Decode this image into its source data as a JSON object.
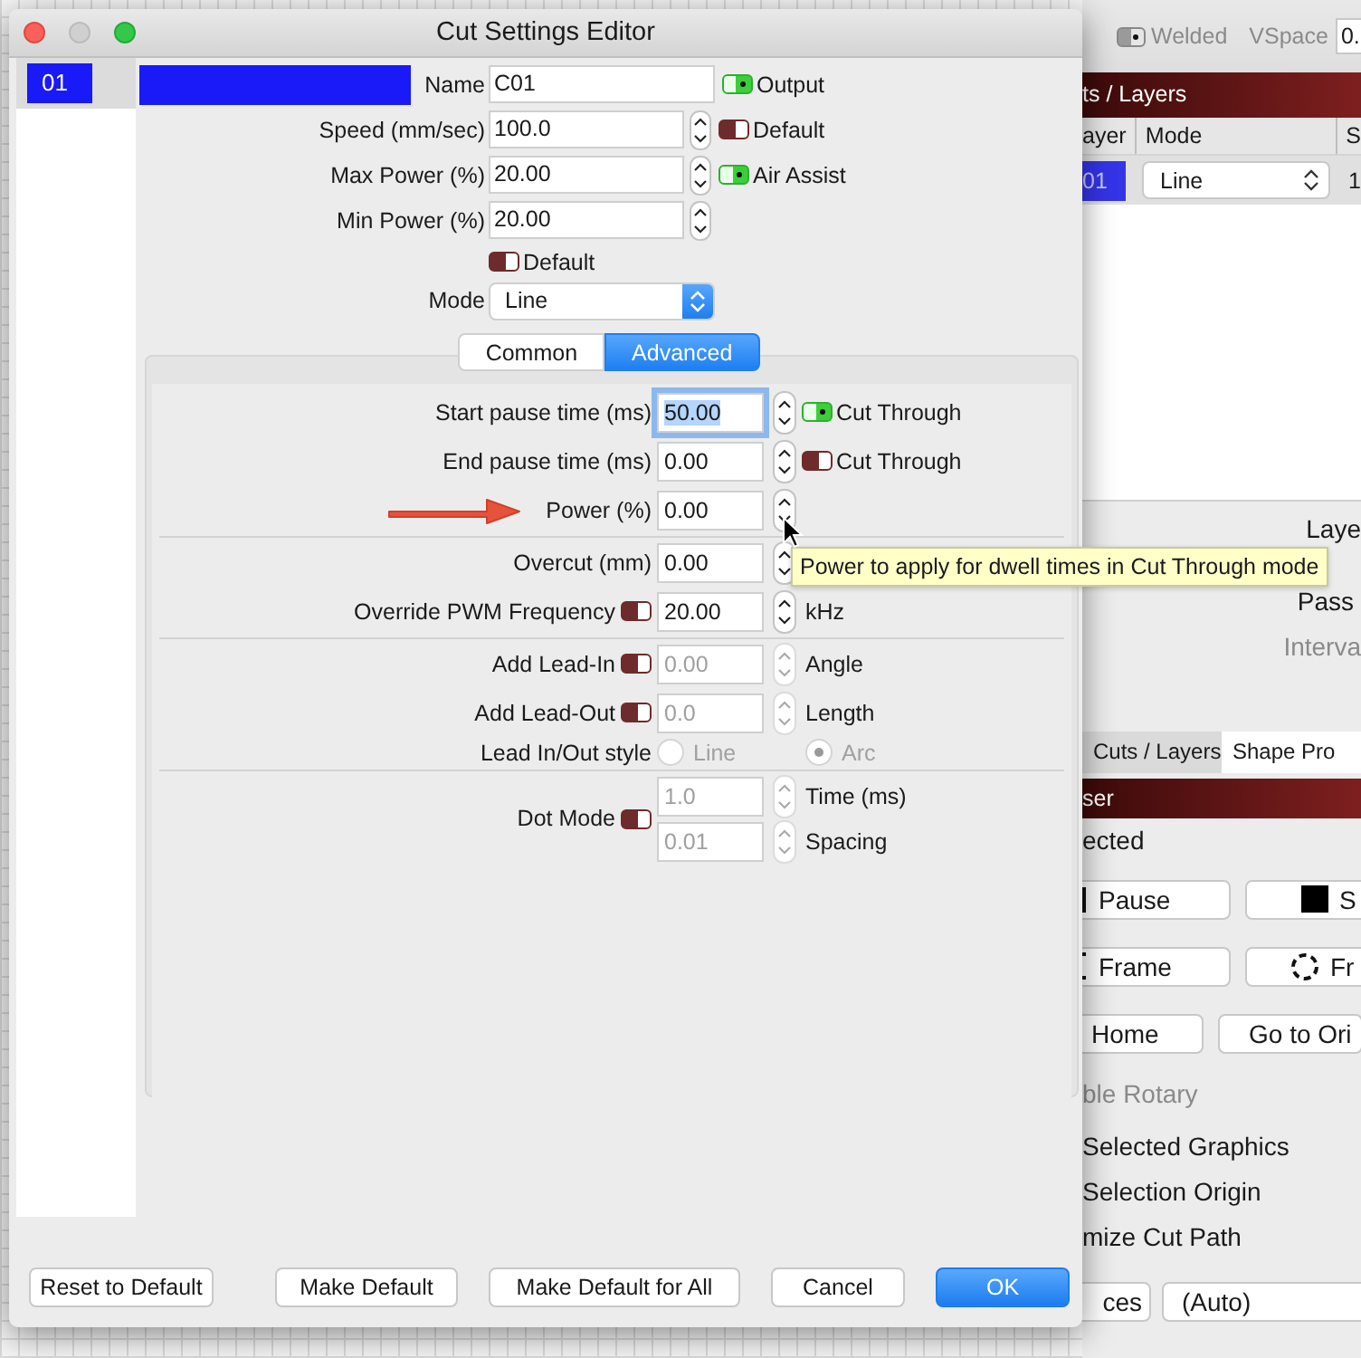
{
  "main_window": {
    "toolbar": {
      "welded": {
        "label": "Welded",
        "checked": true
      },
      "vspace": {
        "label": "VSpace",
        "value": "0."
      }
    },
    "cuts_panel": {
      "title": "ts / Layers",
      "columns": [
        "ayer",
        "Mode",
        "S"
      ],
      "rows": [
        {
          "layer": "01",
          "color": "#3434e8",
          "mode": "Line",
          "speed": "1"
        }
      ]
    },
    "settings": [
      {
        "text": "Laye",
        "disabled": false
      },
      {
        "text": "Pass",
        "disabled": false
      },
      {
        "text": "Interva",
        "disabled": true
      }
    ],
    "tabs": [
      {
        "label": "Cuts / Layers",
        "selected": true
      },
      {
        "label": "Shape Pro",
        "selected": false
      }
    ],
    "laser_panel": {
      "title": "ser",
      "status": "ected",
      "button_rows": [
        [
          {
            "label": "Pause",
            "kind": "pause"
          },
          {
            "label": "S",
            "kind": "stop"
          }
        ],
        [
          {
            "label": "Frame",
            "kind": "frame"
          },
          {
            "label": "Fr",
            "kind": "circle"
          }
        ],
        [
          {
            "label": "Home",
            "kind": "plain"
          },
          {
            "label": "Go to Ori",
            "kind": "plain"
          }
        ]
      ],
      "rotary": {
        "label": "ble Rotary",
        "disabled": true
      },
      "options": [
        "Selected Graphics",
        "Selection Origin",
        "mize Cut Path"
      ],
      "footer": {
        "button": "ces",
        "select": "(Auto)"
      }
    }
  },
  "dialog": {
    "title": "Cut Settings Editor",
    "layers": [
      {
        "label": "01",
        "color": "#1a1af8",
        "selected": true
      }
    ],
    "fields": [
      {
        "label": "Name",
        "value": "C01",
        "kind": "text",
        "toggle": {
          "label": "Output",
          "on": true
        }
      },
      {
        "label": "Speed (mm/sec)",
        "value": "100.0",
        "kind": "number",
        "toggle": {
          "label": "Default",
          "on": false
        }
      },
      {
        "label": "Max Power (%)",
        "value": "20.00",
        "kind": "number",
        "toggle": {
          "label": "Air Assist",
          "on": true
        }
      },
      {
        "label": "Min Power (%)",
        "value": "20.00",
        "kind": "number"
      }
    ],
    "default_toggle": {
      "label": "Default",
      "on": false
    },
    "mode": {
      "label": "Mode",
      "value": "Line"
    },
    "tabs": [
      {
        "label": "Common",
        "selected": false
      },
      {
        "label": "Advanced",
        "selected": true
      }
    ],
    "sections": [
      [
        {
          "kind": "number",
          "label": "Start pause time (ms)",
          "value": "50.00",
          "focused": true,
          "disabled": false,
          "toggle": {
            "label": "Cut Through",
            "on": true
          }
        },
        {
          "kind": "number",
          "label": "End pause time (ms)",
          "value": "0.00",
          "focused": false,
          "disabled": false,
          "toggle": {
            "label": "Cut Through",
            "on": false
          }
        },
        {
          "kind": "number",
          "label": "Power (%)",
          "value": "0.00",
          "focused": false,
          "disabled": false,
          "arrow": true
        }
      ],
      [
        {
          "kind": "number",
          "label": "Overcut (mm)",
          "value": "0.00",
          "focused": false,
          "disabled": false
        },
        {
          "kind": "number",
          "label": "Override PWM Frequency",
          "lead_toggle": {
            "on": false
          },
          "value": "20.00",
          "focused": false,
          "disabled": false,
          "unit": "kHz"
        }
      ],
      [
        {
          "kind": "number",
          "label": "Add Lead-In",
          "lead_toggle": {
            "on": false
          },
          "value": "0.00",
          "focused": false,
          "disabled": true,
          "unit": "Angle"
        },
        {
          "kind": "number",
          "label": "Add Lead-Out",
          "lead_toggle": {
            "on": false
          },
          "value": "0.0",
          "focused": false,
          "disabled": true,
          "unit": "Length"
        },
        {
          "kind": "radio",
          "label": "Lead In/Out style",
          "disabled": true,
          "options": [
            {
              "label": "Line",
              "selected": false
            },
            {
              "label": "Arc",
              "selected": true
            }
          ]
        }
      ],
      [
        {
          "kind": "dual",
          "label": "Dot Mode",
          "lead_toggle": {
            "on": false
          },
          "disabled": true,
          "inputs": [
            {
              "value": "1.0",
              "unit": "Time (ms)"
            },
            {
              "value": "0.01",
              "unit": "Spacing"
            }
          ]
        }
      ]
    ],
    "tooltip": "Power to apply for dwell times in Cut Through mode",
    "buttons": [
      {
        "label": "Reset to Default",
        "primary": false
      },
      {
        "label": "Make Default",
        "primary": false
      },
      {
        "label": "Make Default for All",
        "primary": false
      },
      {
        "label": "Cancel",
        "primary": false
      },
      {
        "label": "OK",
        "primary": true
      }
    ]
  }
}
